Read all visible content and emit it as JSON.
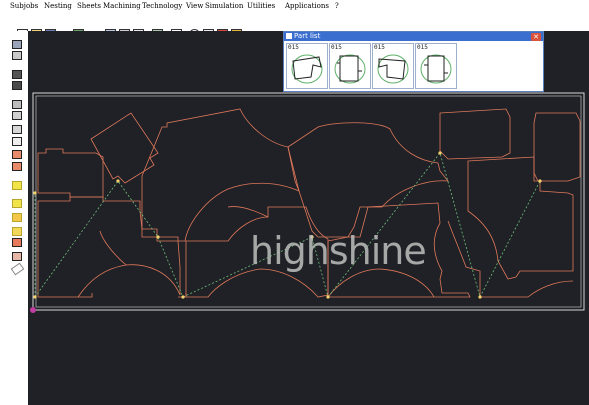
{
  "menu": [
    "Subjobs",
    "Nesting",
    "Sheets",
    "Machining",
    "Technology",
    "View",
    "Simulation",
    "Utilities",
    "Applications",
    "?"
  ],
  "toolbar_icons": [
    "new-file-icon",
    "open-file-icon",
    "save-icon",
    "layers-icon",
    "dropdown-arrow-icon",
    "chart-icon",
    "print-icon",
    "print-preview-icon",
    "copy-icon",
    "window-icon",
    "zoom-icon",
    "table-icon",
    "color-icon",
    "info-icon"
  ],
  "left_tool_icons": [
    "tool-1-icon",
    "tool-2-icon",
    "tool-3-icon",
    "tool-4-icon",
    "tool-5-icon",
    "tool-6-icon",
    "tool-7-icon",
    "tool-8-icon",
    "tool-9-icon",
    "tool-10-icon",
    "tool-11-icon",
    "tool-12-icon",
    "tool-13-icon",
    "tool-14-icon",
    "tool-15-icon",
    "tool-16-icon"
  ],
  "part_list": {
    "title": "Part list",
    "parts": [
      {
        "label": "015"
      },
      {
        "label": "015"
      },
      {
        "label": "015"
      },
      {
        "label": "015"
      }
    ]
  },
  "watermark": "highshine",
  "colors": {
    "canvas": "#1f2126",
    "part_outline": "#e0785a",
    "sheet_border": "#d8d8d8",
    "toolpath": "#6fbf7a",
    "pierce_point": "#f3d36b"
  }
}
